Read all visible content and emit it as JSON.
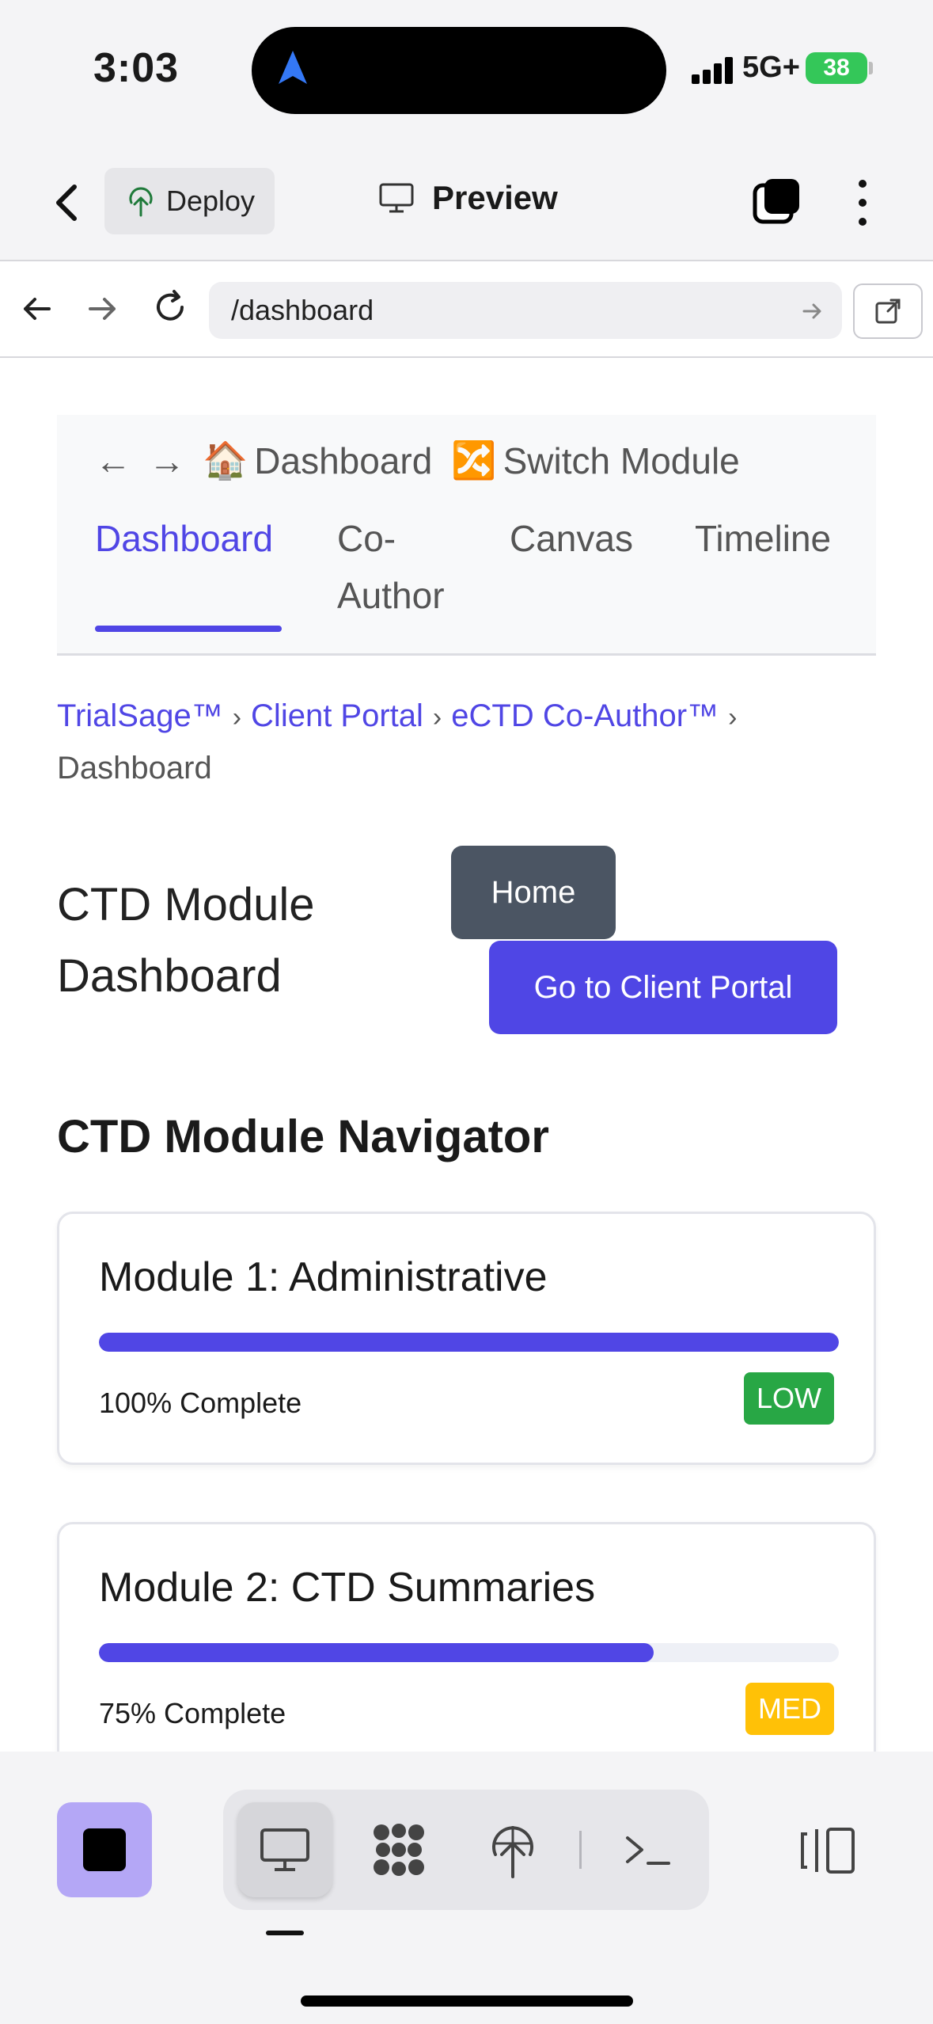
{
  "status_bar": {
    "time": "3:03",
    "network": "5G+",
    "battery": "38"
  },
  "app_header": {
    "deploy_label": "Deploy",
    "preview_label": "Preview"
  },
  "url_bar": {
    "url": "/dashboard"
  },
  "site_nav": {
    "dashboard_link": "Dashboard",
    "switch_module": "Switch Module",
    "tabs": [
      {
        "label": "Dashboard",
        "active": true
      },
      {
        "label": "Co-",
        "label2": "Author",
        "active": false
      },
      {
        "label": "Canvas",
        "active": false
      },
      {
        "label": "Timeline",
        "active": false
      }
    ]
  },
  "breadcrumb": {
    "items": [
      "TrialSage™",
      "Client Portal",
      "eCTD Co-Author™"
    ],
    "current": "Dashboard",
    "separator": "›"
  },
  "page": {
    "title": "CTD Module Dashboard",
    "home_button": "Home",
    "portal_button": "Go to Client Portal"
  },
  "navigator": {
    "title": "CTD Module Navigator",
    "modules": [
      {
        "name": "Module 1: Administrative",
        "progress": 100,
        "status": "100% Complete",
        "risk": "LOW",
        "risk_color": "#28a745"
      },
      {
        "name": "Module 2: CTD Summaries",
        "progress": 75,
        "status": "75% Complete",
        "risk": "MED",
        "risk_color": "#ffc107"
      }
    ]
  },
  "colors": {
    "accent": "#5046e5",
    "button_dark": "#4b5563",
    "stop_button": "#b4a7f6"
  },
  "bottom_toolbar": {
    "icons": [
      "stop-icon",
      "desktop-icon",
      "apps-icon",
      "deploy-icon",
      "terminal-icon",
      "panel-toggle-icon"
    ]
  }
}
